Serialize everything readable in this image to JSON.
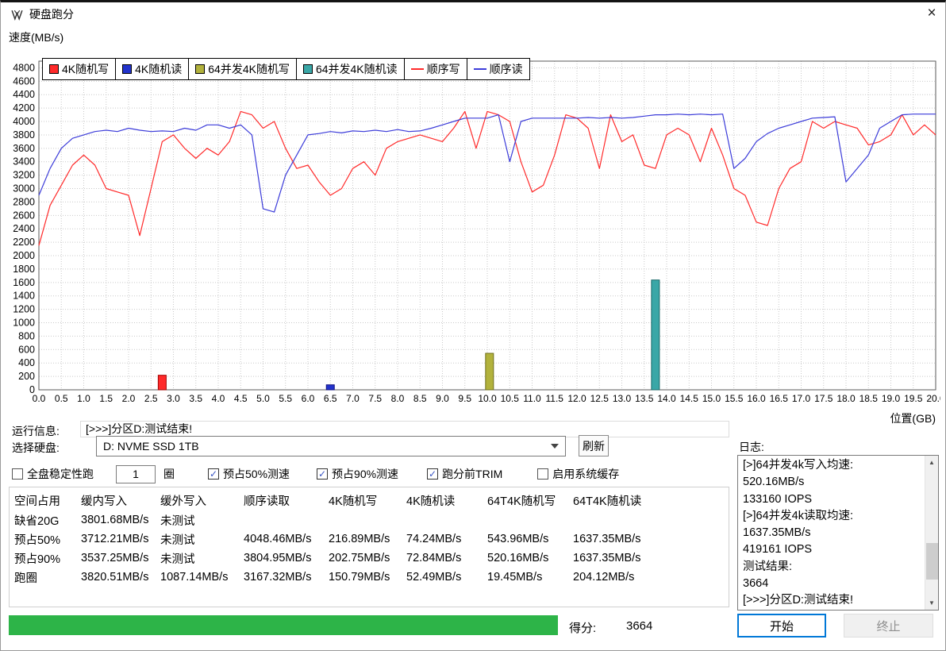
{
  "window": {
    "title": "硬盘跑分",
    "close_label": "×"
  },
  "icons": {
    "scroll_up": "▲",
    "scroll_down": "▼",
    "check": "✓"
  },
  "chart": {
    "speed_label": "速度(MB/s)",
    "position_label": "位置(GB)"
  },
  "chart_data": {
    "type": "line",
    "title": "",
    "xlabel": "位置(GB)",
    "ylabel": "速度(MB/s)",
    "xlim": [
      0,
      20
    ],
    "ylim": [
      0,
      4900
    ],
    "x_tick_step": 0.5,
    "y_tick_step": 200,
    "y_tick_max": 4800,
    "grid": true,
    "legend_position": "top-left",
    "legend": [
      {
        "label": "4K随机写",
        "color": "#ff2a2a",
        "swatch": "box"
      },
      {
        "label": "4K随机读",
        "color": "#2233cc",
        "swatch": "box"
      },
      {
        "label": "64并发4K随机写",
        "color": "#b2b23c",
        "swatch": "box"
      },
      {
        "label": "64并发4K随机读",
        "color": "#3aa7a7",
        "swatch": "box"
      },
      {
        "label": "顺序写",
        "color": "#ff2a2a",
        "swatch": "line"
      },
      {
        "label": "顺序读",
        "color": "#3c3cd9",
        "swatch": "line"
      }
    ],
    "x_start": 0,
    "x_step": 0.25,
    "series": [
      {
        "name": "顺序写",
        "color": "#ff2a2a",
        "y": [
          2150,
          2750,
          3050,
          3350,
          3500,
          3350,
          3000,
          2950,
          2900,
          2300,
          3000,
          3700,
          3800,
          3600,
          3450,
          3600,
          3500,
          3700,
          4150,
          4100,
          3900,
          4000,
          3600,
          3300,
          3350,
          3100,
          2900,
          3000,
          3300,
          3400,
          3200,
          3600,
          3700,
          3750,
          3800,
          3750,
          3700,
          3900,
          4150,
          3600,
          4150,
          4100,
          4000,
          3400,
          2950,
          3050,
          3500,
          4100,
          4050,
          3900,
          3300,
          4100,
          3700,
          3800,
          3350,
          3300,
          3800,
          3900,
          3800,
          3400,
          3900,
          3500,
          3000,
          2900,
          2500,
          2450,
          3000,
          3300,
          3400,
          4000,
          3900,
          4000,
          3950,
          3900,
          3650,
          3700,
          3800,
          4100,
          3800,
          3950,
          3800
        ]
      },
      {
        "name": "顺序读",
        "color": "#3c3cd9",
        "y": [
          2900,
          3300,
          3600,
          3750,
          3800,
          3850,
          3870,
          3850,
          3900,
          3870,
          3850,
          3860,
          3850,
          3900,
          3870,
          3950,
          3950,
          3900,
          3950,
          3800,
          2700,
          2650,
          3200,
          3500,
          3800,
          3820,
          3850,
          3830,
          3860,
          3850,
          3870,
          3850,
          3880,
          3850,
          3860,
          3900,
          3950,
          4000,
          4050,
          4050,
          4050,
          4100,
          3400,
          4000,
          4050,
          4050,
          4050,
          4050,
          4050,
          4060,
          4050,
          4060,
          4050,
          4060,
          4080,
          4100,
          4100,
          4110,
          4100,
          4110,
          4100,
          4110,
          3300,
          3450,
          3700,
          3820,
          3900,
          3950,
          4000,
          4050,
          4060,
          4070,
          3100,
          3300,
          3500,
          3900,
          4000,
          4100,
          4110,
          4110,
          4110
        ]
      }
    ],
    "bars": [
      {
        "name": "4K随机写",
        "x": 2.75,
        "value": 216.89,
        "color": "#ff2a2a",
        "edge": "#a00000"
      },
      {
        "name": "4K随机读",
        "x": 6.5,
        "value": 74.24,
        "color": "#2233cc",
        "edge": "#101080"
      },
      {
        "name": "64并发4K随机写",
        "x": 10.05,
        "value": 543.96,
        "color": "#b2b23c",
        "edge": "#6f6f1a"
      },
      {
        "name": "64并发4K随机读",
        "x": 13.75,
        "value": 1637.35,
        "color": "#3aa7a7",
        "edge": "#1c6a6a"
      }
    ]
  },
  "run_info": {
    "label": "运行信息:",
    "value": "[>>>]分区D:测试结束!"
  },
  "disk_select": {
    "label": "选择硬盘:",
    "value": "D: NVME SSD 1TB",
    "refresh_label": "刷新"
  },
  "options": {
    "stability": {
      "label": "全盘稳定性跑",
      "checked": false
    },
    "loops_value": "1",
    "loops_unit": "圈",
    "pre50": {
      "label": "预占50%测速",
      "checked": true
    },
    "pre90": {
      "label": "预占90%测速",
      "checked": true
    },
    "trim": {
      "label": "跑分前TRIM",
      "checked": true
    },
    "syscache": {
      "label": "启用系统缓存",
      "checked": false
    }
  },
  "results_table": {
    "headers": [
      "空间占用",
      "缓内写入",
      "缓外写入",
      "顺序读取",
      "4K随机写",
      "4K随机读",
      "64T4K随机写",
      "64T4K随机读"
    ],
    "rows": [
      [
        "缺省20G",
        "3801.68MB/s",
        "未测试",
        "",
        "",
        "",
        "",
        ""
      ],
      [
        "预占50%",
        "3712.21MB/s",
        "未测试",
        "4048.46MB/s",
        "216.89MB/s",
        "74.24MB/s",
        "543.96MB/s",
        "1637.35MB/s"
      ],
      [
        "预占90%",
        "3537.25MB/s",
        "未测试",
        "3804.95MB/s",
        "202.75MB/s",
        "72.84MB/s",
        "520.16MB/s",
        "1637.35MB/s"
      ],
      [
        "跑圈",
        "3820.51MB/s",
        "1087.14MB/s",
        "3167.32MB/s",
        "150.79MB/s",
        "52.49MB/s",
        "19.45MB/s",
        "204.12MB/s"
      ]
    ]
  },
  "log": {
    "label": "日志:",
    "lines": [
      "[>]64并发4k写入均速:",
      "520.16MB/s",
      "133160 IOPS",
      "[>]64并发4k读取均速:",
      "1637.35MB/s",
      "419161 IOPS",
      "测试结果:",
      "3664",
      "[>>>]分区D:测试结束!"
    ]
  },
  "footer": {
    "score_label": "得分:",
    "score_value": "3664",
    "start_label": "开始",
    "stop_label": "终止",
    "progress_percent": 100,
    "progress_color": "#2db448"
  }
}
